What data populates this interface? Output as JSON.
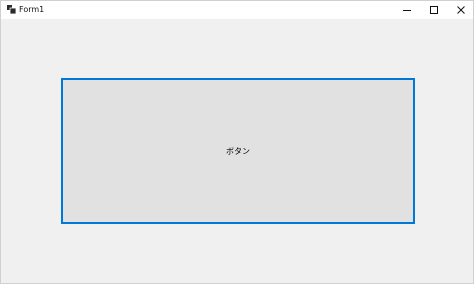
{
  "window": {
    "title": "Form1"
  },
  "caption_buttons": {
    "minimize_icon": "minimize-icon",
    "maximize_icon": "maximize-icon",
    "close_icon": "close-icon"
  },
  "main": {
    "button_label": "ボタン"
  },
  "colors": {
    "window_bg": "#f0f0f0",
    "button_bg": "#e1e1e1",
    "focus_border": "#0078d7"
  }
}
